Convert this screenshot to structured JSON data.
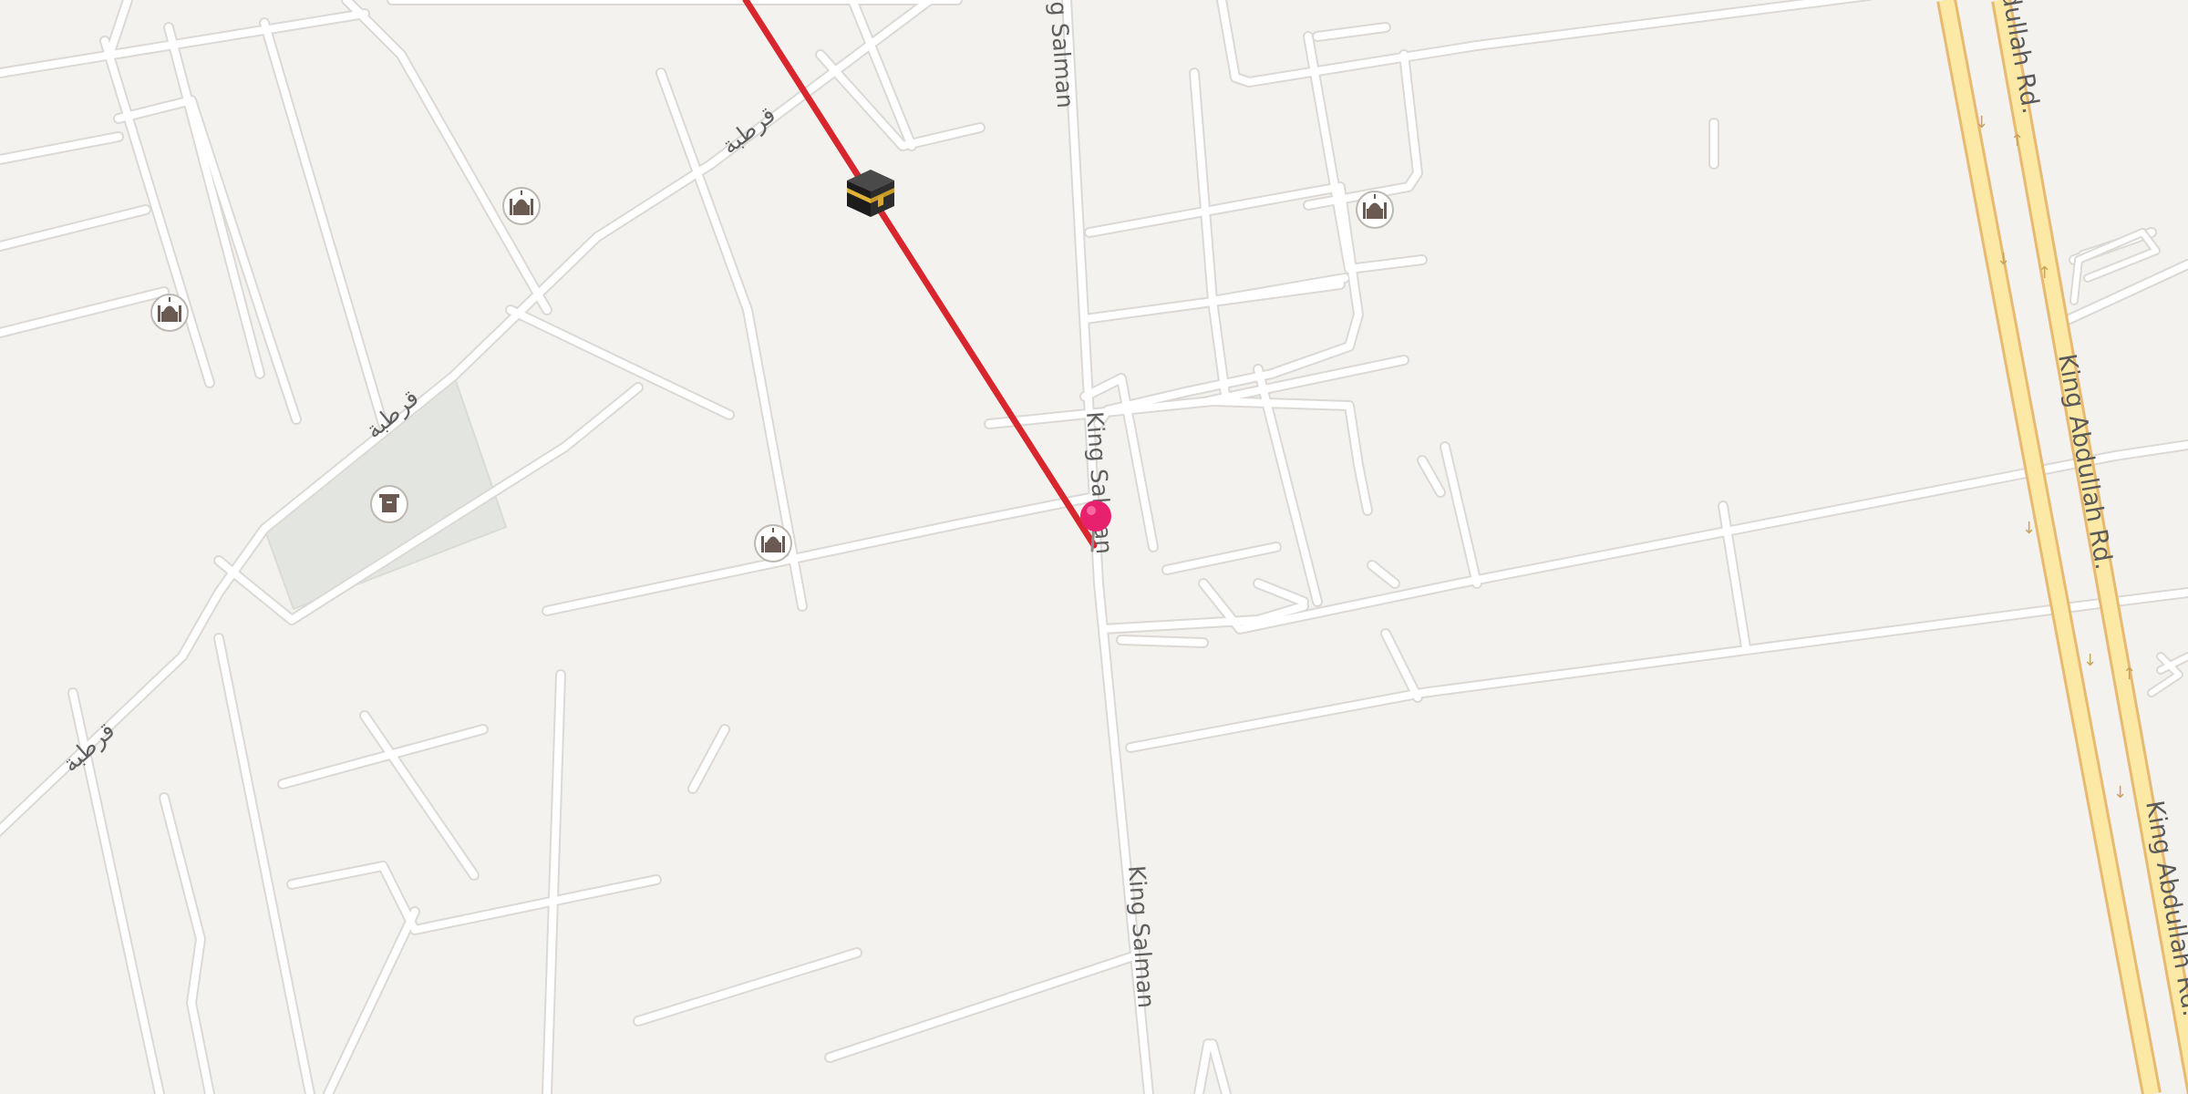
{
  "map": {
    "qibla_line_color": "#d7262e",
    "pin_color": "#e8216f",
    "park_color": "#e3e6e0",
    "highway_color": "#fde9a6",
    "highway_edge_color": "#e7b971",
    "road_color": "#ffffff",
    "background_color": "#f4f2ef",
    "streets": {
      "king_salman_top": "g Salman",
      "king_salman_mid": "King Salman",
      "king_salman_low": "King Salman",
      "king_abdullah_a": "dullah Rd.",
      "king_abdullah_b": "King Abdullah Rd.",
      "king_abdullah_c": "King Abdullah Rd.",
      "qurtuba_1": "قرطبة",
      "qurtuba_2": "قرطبة",
      "qurtuba_3": "قرطبة"
    },
    "markers": {
      "kaaba": "kaaba-icon",
      "location_pin": "location-pin-icon",
      "mosques": [
        "mosque-icon",
        "mosque-icon",
        "mosque-icon",
        "mosque-icon"
      ],
      "cemetery": "cemetery-icon"
    }
  }
}
